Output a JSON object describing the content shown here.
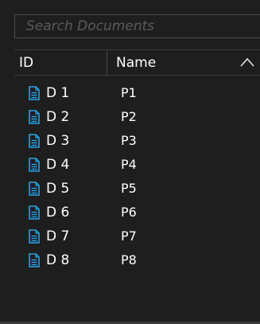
{
  "search": {
    "placeholder": "Search Documents",
    "value": ""
  },
  "columns": {
    "id": "ID",
    "name": "Name",
    "sort_icon": "chevron-up-icon"
  },
  "colors": {
    "icon": "#29a3e6",
    "background": "#1e1e1e",
    "text": "#ffffff"
  },
  "rows": [
    {
      "id": "D 1",
      "name": "P1",
      "icon": "document-icon"
    },
    {
      "id": "D 2",
      "name": "P2",
      "icon": "document-icon"
    },
    {
      "id": "D 3",
      "name": "P3",
      "icon": "document-icon"
    },
    {
      "id": "D 4",
      "name": "P4",
      "icon": "document-icon"
    },
    {
      "id": "D 5",
      "name": "P5",
      "icon": "document-icon"
    },
    {
      "id": "D 6",
      "name": "P6",
      "icon": "document-icon"
    },
    {
      "id": "D 7",
      "name": "P7",
      "icon": "document-icon"
    },
    {
      "id": "D 8",
      "name": "P8",
      "icon": "document-icon"
    }
  ]
}
